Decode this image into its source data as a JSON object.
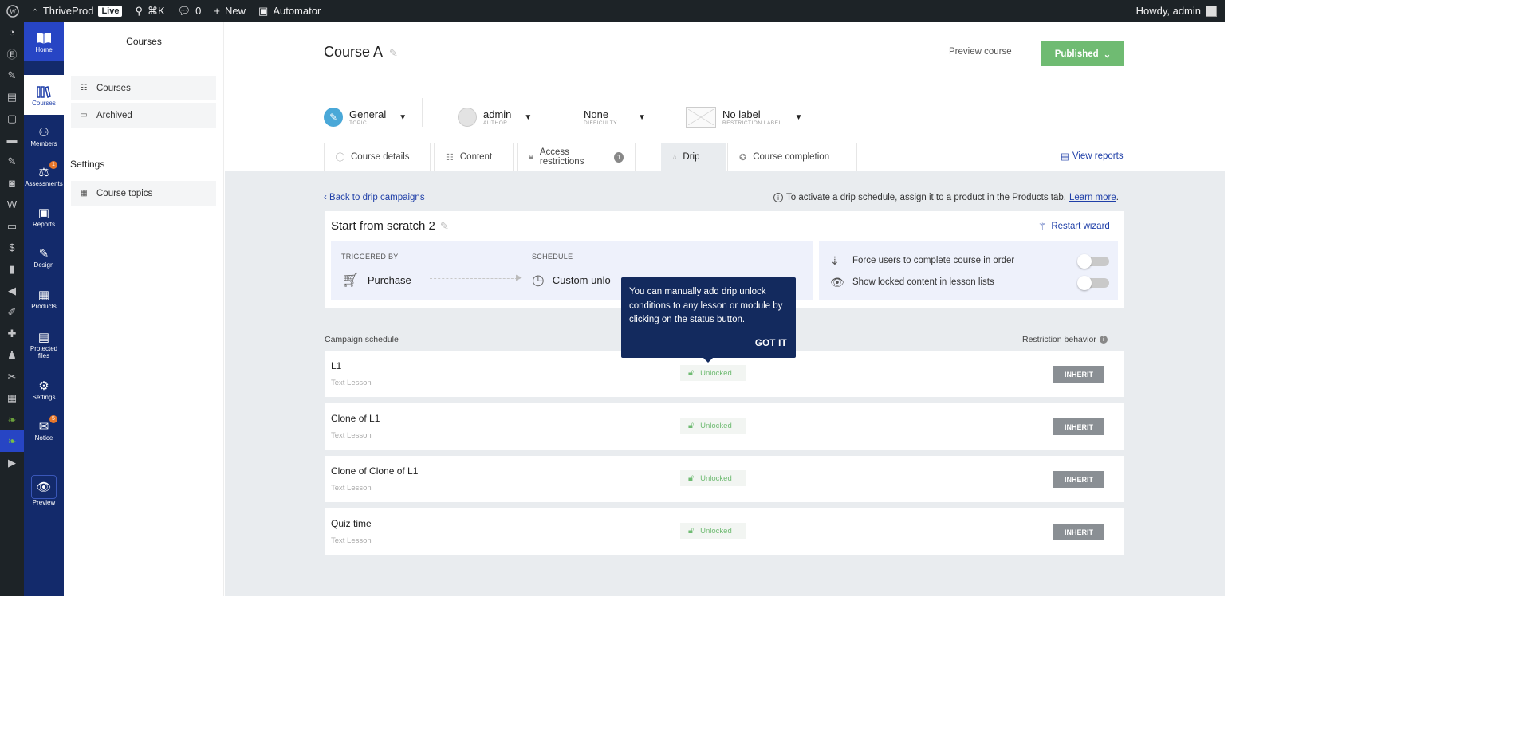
{
  "adminbar": {
    "site_name": "ThriveProd",
    "live_badge": "Live",
    "search_shortcut": "⌘K",
    "comments_count": "0",
    "new_label": "New",
    "automator_label": "Automator",
    "howdy": "Howdy, admin"
  },
  "appnav": {
    "items": [
      {
        "label": "Home",
        "icon": "book-open-icon"
      },
      {
        "label": "Courses",
        "icon": "books-icon"
      },
      {
        "label": "Members",
        "icon": "users-icon"
      },
      {
        "label": "Assessments",
        "icon": "scales-icon",
        "badge": "1"
      },
      {
        "label": "Reports",
        "icon": "reports-icon"
      },
      {
        "label": "Design",
        "icon": "brush-icon"
      },
      {
        "label": "Products",
        "icon": "products-icon"
      },
      {
        "label": "Protected files",
        "icon": "file-lock-icon"
      },
      {
        "label": "Settings",
        "icon": "gear-icon"
      },
      {
        "label": "Notice",
        "icon": "inbox-icon",
        "badge": "5"
      },
      {
        "label": "Preview",
        "icon": "eye-icon"
      }
    ]
  },
  "courses_panel": {
    "title": "Courses",
    "items": [
      {
        "label": "Courses"
      },
      {
        "label": "Archived"
      }
    ],
    "settings_heading": "Settings",
    "settings_items": [
      {
        "label": "Course topics"
      }
    ]
  },
  "header": {
    "course_title": "Course A",
    "preview_label": "Preview course",
    "published_label": "Published",
    "meta": {
      "topic_value": "General",
      "topic_label": "TOPIC",
      "author_value": "admin",
      "author_label": "AUTHOR",
      "difficulty_value": "None",
      "difficulty_label": "DIFFICULTY",
      "restriction_value": "No label",
      "restriction_label": "RESTRICTION LABEL"
    }
  },
  "tabs": {
    "items": [
      {
        "label": "Course details"
      },
      {
        "label": "Content"
      },
      {
        "label": "Access restrictions",
        "count": "1"
      },
      {
        "label": "Drip"
      },
      {
        "label": "Course completion"
      }
    ],
    "view_reports": "View reports"
  },
  "drip": {
    "back_link": "Back to drip campaigns",
    "activate_note": "To activate a drip schedule, assign it to a product in the Products tab.",
    "learn_more": "Learn more",
    "note_end": ".",
    "campaign_name": "Start from scratch 2",
    "restart_wizard": "Restart wizard",
    "triggered_by_label": "TRIGGERED BY",
    "trigger_value": "Purchase",
    "schedule_label": "SCHEDULE",
    "schedule_value": "Custom unlo",
    "settings": {
      "force_order": "Force users to complete course in order",
      "show_locked": "Show locked content in lesson lists"
    },
    "campaign_schedule_label": "Campaign schedule",
    "restriction_behavior_label": "Restriction behavior",
    "rows": [
      {
        "name": "L1",
        "type": "Text Lesson",
        "status": "Unlocked",
        "behavior": "INHERIT"
      },
      {
        "name": "Clone of L1",
        "type": "Text Lesson",
        "status": "Unlocked",
        "behavior": "INHERIT"
      },
      {
        "name": "Clone of Clone of L1",
        "type": "Text Lesson",
        "status": "Unlocked",
        "behavior": "INHERIT"
      },
      {
        "name": "Quiz time",
        "type": "Text Lesson",
        "status": "Unlocked",
        "behavior": "INHERIT"
      }
    ]
  },
  "tooltip": {
    "text": "You can manually add drip unlock conditions to any lesson or module by clicking on the status button.",
    "button": "GOT IT"
  },
  "colors": {
    "nav_bg": "#132a6b",
    "accent": "#1f3fa8",
    "published": "#6fbb72",
    "content_bg": "#e9ecef",
    "tooltip_bg": "#132a5e"
  }
}
